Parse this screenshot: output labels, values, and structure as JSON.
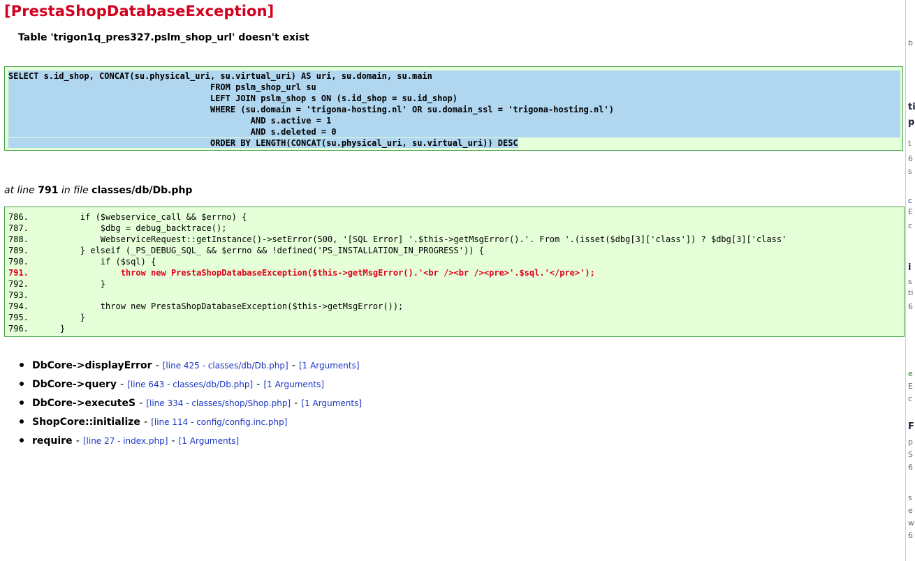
{
  "exception": {
    "title": "[PrestaShopDatabaseException]",
    "message": "Table 'trigon1q_pres327.pslm_shop_url' doesn't exist"
  },
  "sql": {
    "lines": [
      "SELECT s.id_shop, CONCAT(su.physical_uri, su.virtual_uri) AS uri, su.domain, su.main",
      "                                        FROM pslm_shop_url su",
      "                                        LEFT JOIN pslm_shop s ON (s.id_shop = su.id_shop)",
      "                                        WHERE (su.domain = 'trigona-hosting.nl' OR su.domain_ssl = 'trigona-hosting.nl')",
      "                                                AND s.active = 1",
      "                                                AND s.deleted = 0",
      "                                        ORDER BY LENGTH(CONCAT(su.physical_uri, su.virtual_uri)) DESC"
    ]
  },
  "location": {
    "prefix": "at line",
    "line": "791",
    "in_file": "in file",
    "file": "classes/db/Db.php"
  },
  "code": {
    "lines": [
      {
        "num": "786.",
        "text": "            if ($webservice_call && $errno) {",
        "highlight": false
      },
      {
        "num": "787.",
        "text": "                $dbg = debug_backtrace();",
        "highlight": false
      },
      {
        "num": "788.",
        "text": "                WebserviceRequest::getInstance()->setError(500, '[SQL Error] '.$this->getMsgError().'. From '.(isset($dbg[3]['class']) ? $dbg[3]['class'",
        "highlight": false
      },
      {
        "num": "789.",
        "text": "            } elseif (_PS_DEBUG_SQL_ && $errno && !defined('PS_INSTALLATION_IN_PROGRESS')) {",
        "highlight": false
      },
      {
        "num": "790.",
        "text": "                if ($sql) {",
        "highlight": false
      },
      {
        "num": "791.",
        "text": "                    throw new PrestaShopDatabaseException($this->getMsgError().'<br /><br /><pre>'.$sql.'</pre>');",
        "highlight": true
      },
      {
        "num": "792.",
        "text": "                }",
        "highlight": false
      },
      {
        "num": "793.",
        "text": "",
        "highlight": false
      },
      {
        "num": "794.",
        "text": "                throw new PrestaShopDatabaseException($this->getMsgError());",
        "highlight": false
      },
      {
        "num": "795.",
        "text": "            }",
        "highlight": false
      },
      {
        "num": "796.",
        "text": "        }",
        "highlight": false
      }
    ]
  },
  "trace": [
    {
      "function": "DbCore->displayError",
      "location": "[line 425 - classes/db/Db.php]",
      "arguments": "[1 Arguments]"
    },
    {
      "function": "DbCore->query",
      "location": "[line 643 - classes/db/Db.php]",
      "arguments": "[1 Arguments]"
    },
    {
      "function": "DbCore->executeS",
      "location": "[line 334 - classes/shop/Shop.php]",
      "arguments": "[1 Arguments]"
    },
    {
      "function": "ShopCore::initialize",
      "location": "[line 114 - config/config.inc.php]",
      "arguments": null
    },
    {
      "function": "require",
      "location": "[line 27 - index.php]",
      "arguments": "[1 Arguments]"
    }
  ],
  "separator": "-",
  "colors": {
    "title": "#d1001f",
    "box_background": "#e5ffd9",
    "box_border": "#43a047",
    "selection": "#b0d6f0",
    "highlight_line": "#e0001b",
    "link": "#1a35c4"
  }
}
